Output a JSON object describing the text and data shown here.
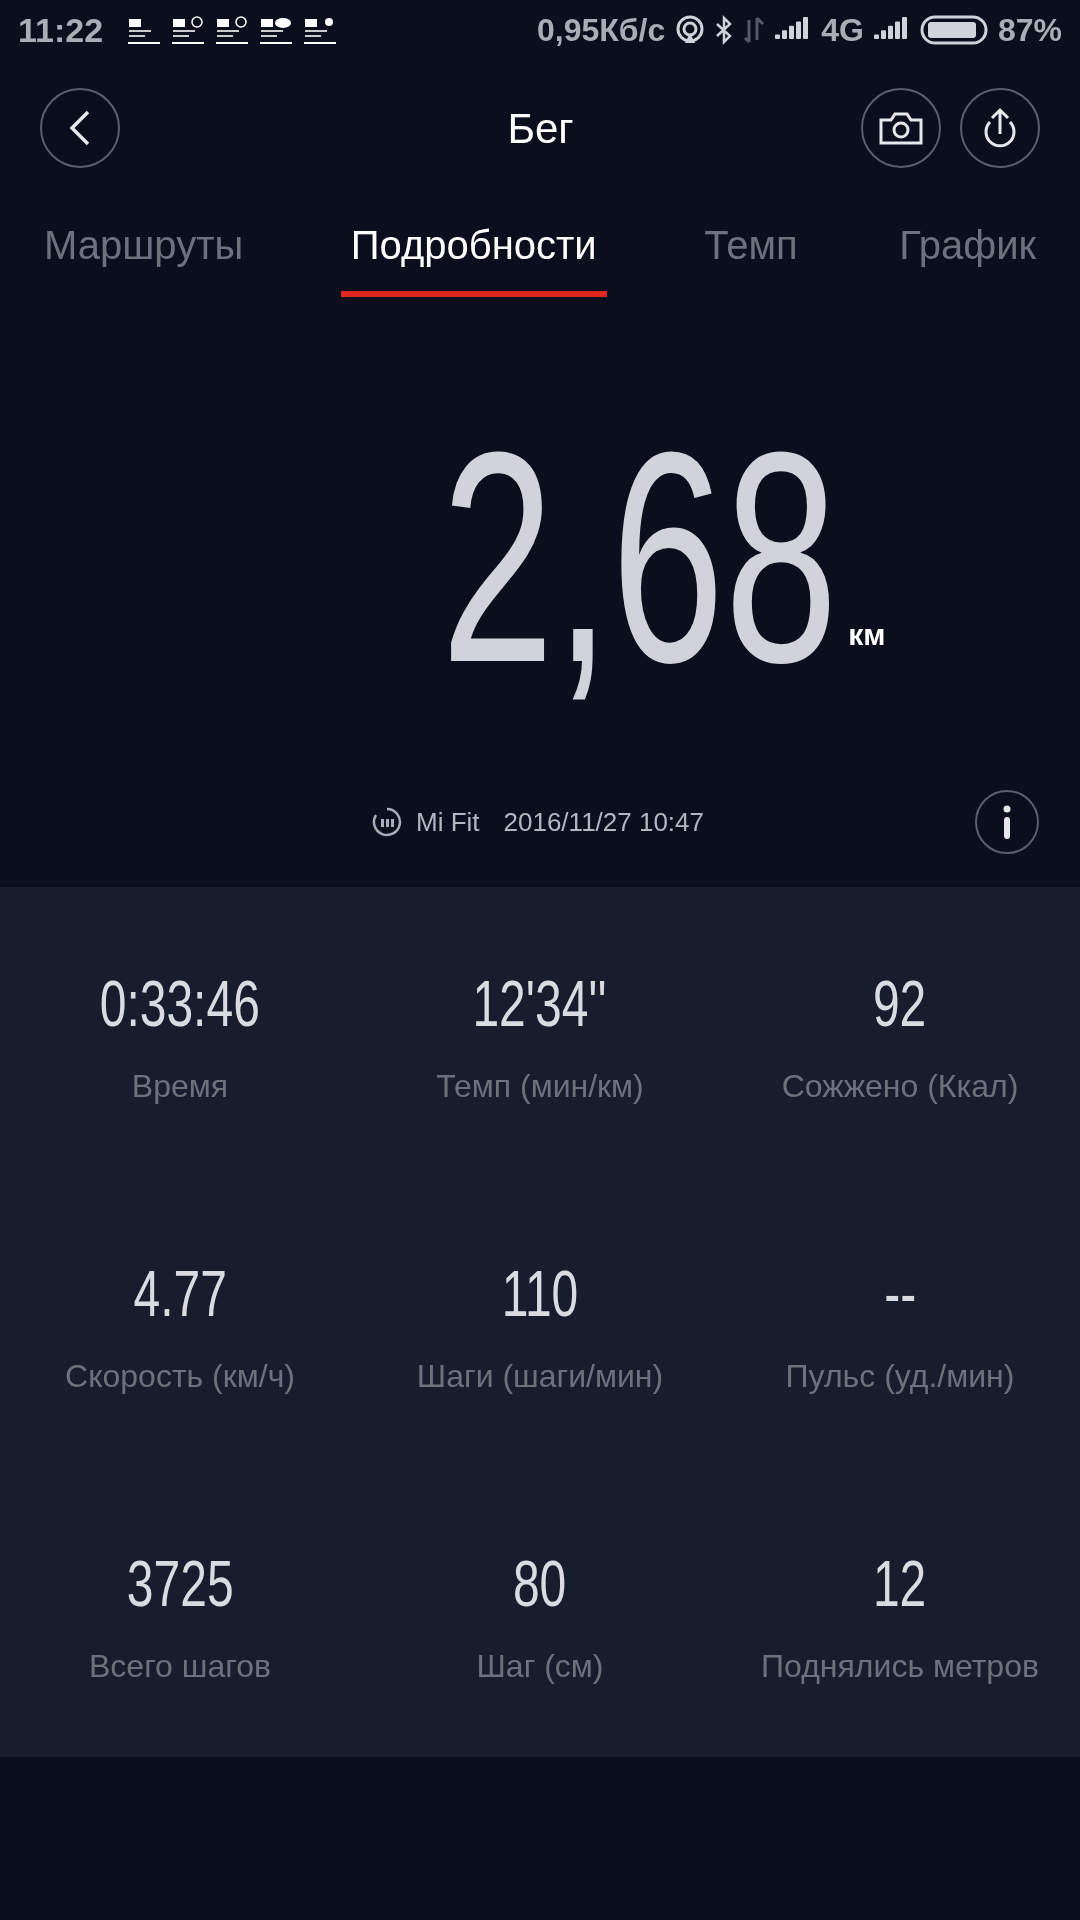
{
  "status_bar": {
    "time": "11:22",
    "speed": "0,95Кб/с",
    "network": "4G",
    "battery": "87%"
  },
  "header": {
    "title": "Бег"
  },
  "tabs": [
    {
      "label": "Маршруты",
      "selected": false
    },
    {
      "label": "Подробности",
      "selected": true
    },
    {
      "label": "Темп",
      "selected": false
    },
    {
      "label": "График",
      "selected": false
    }
  ],
  "distance": {
    "value": "2,68",
    "unit": "км"
  },
  "source": {
    "app": "Mi Fit",
    "datetime": "2016/11/27 10:47"
  },
  "stats": [
    {
      "value": "0:33:46",
      "label": "Время"
    },
    {
      "value": "12'34''",
      "label": "Темп (мин/км)"
    },
    {
      "value": "92",
      "label": "Сожжено (Ккал)"
    },
    {
      "value": "4.77",
      "label": "Скорость (км/ч)"
    },
    {
      "value": "110",
      "label": "Шаги (шаги/мин)"
    },
    {
      "value": "--",
      "label": "Пульс (уд./мин)"
    },
    {
      "value": "3725",
      "label": "Всего шагов"
    },
    {
      "value": "80",
      "label": "Шаг (см)"
    },
    {
      "value": "12",
      "label": "Поднялись метров"
    }
  ]
}
